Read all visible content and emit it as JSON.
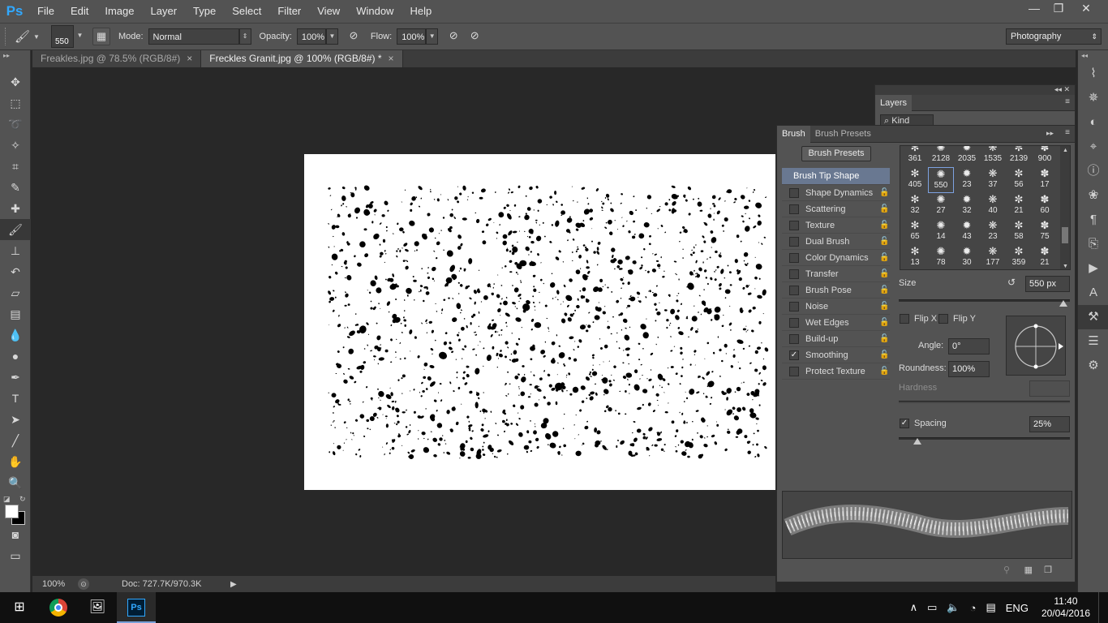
{
  "app": {
    "logo": "Ps"
  },
  "menu": [
    "File",
    "Edit",
    "Image",
    "Layer",
    "Type",
    "Select",
    "Filter",
    "View",
    "Window",
    "Help"
  ],
  "window_controls": {
    "minimize": "—",
    "restore": "❐",
    "close": "✕"
  },
  "options": {
    "brush_size": "550",
    "mode_label": "Mode:",
    "mode_value": "Normal",
    "opacity_label": "Opacity:",
    "opacity_value": "100%",
    "flow_label": "Flow:",
    "flow_value": "100%",
    "workspace": "Photography"
  },
  "tabs": [
    {
      "label": "Freakles.jpg @ 78.5% (RGB/8#)",
      "close": "×"
    },
    {
      "label": "Freckles Granit.jpg @ 100% (RGB/8#) *",
      "close": "×"
    }
  ],
  "status": {
    "zoom": "100%",
    "doc": "Doc: 727.7K/970.3K"
  },
  "layers_panel": {
    "tab": "Layers",
    "kind": "Kind"
  },
  "brush_panel": {
    "tabs": [
      "Brush",
      "Brush Presets"
    ],
    "presets_button": "Brush Presets",
    "header": "Brush Tip Shape",
    "options": [
      {
        "label": "Shape Dynamics",
        "checked": false
      },
      {
        "label": "Scattering",
        "checked": false
      },
      {
        "label": "Texture",
        "checked": false
      },
      {
        "label": "Dual Brush",
        "checked": false
      },
      {
        "label": "Color Dynamics",
        "checked": false
      },
      {
        "label": "Transfer",
        "checked": false
      },
      {
        "label": "Brush Pose",
        "checked": false
      },
      {
        "label": "Noise",
        "checked": false
      },
      {
        "label": "Wet Edges",
        "checked": false
      },
      {
        "label": "Build-up",
        "checked": false
      },
      {
        "label": "Smoothing",
        "checked": true
      },
      {
        "label": "Protect Texture",
        "checked": false
      }
    ],
    "tips": [
      "361",
      "2128",
      "2035",
      "1535",
      "2139",
      "900",
      "405",
      "550",
      "23",
      "37",
      "56",
      "17",
      "32",
      "27",
      "32",
      "40",
      "21",
      "60",
      "65",
      "14",
      "43",
      "23",
      "58",
      "75",
      "13",
      "78",
      "30",
      "177",
      "359",
      "21"
    ],
    "selected_tip": "550",
    "size_label": "Size",
    "size_value": "550 px",
    "size_fraction": 0.96,
    "flip_x": "Flip X",
    "flip_y": "Flip Y",
    "angle_label": "Angle:",
    "angle_value": "0°",
    "roundness_label": "Roundness:",
    "roundness_value": "100%",
    "hardness_label": "Hardness",
    "spacing_label": "Spacing",
    "spacing_checked": true,
    "spacing_value": "25%",
    "spacing_fraction": 0.11
  },
  "taskbar": {
    "lang": "ENG",
    "time": "11:40",
    "date": "20/04/2016"
  },
  "colors": {
    "accent": "#31a8ff",
    "panel": "#535353",
    "selected_row": "#697891"
  }
}
